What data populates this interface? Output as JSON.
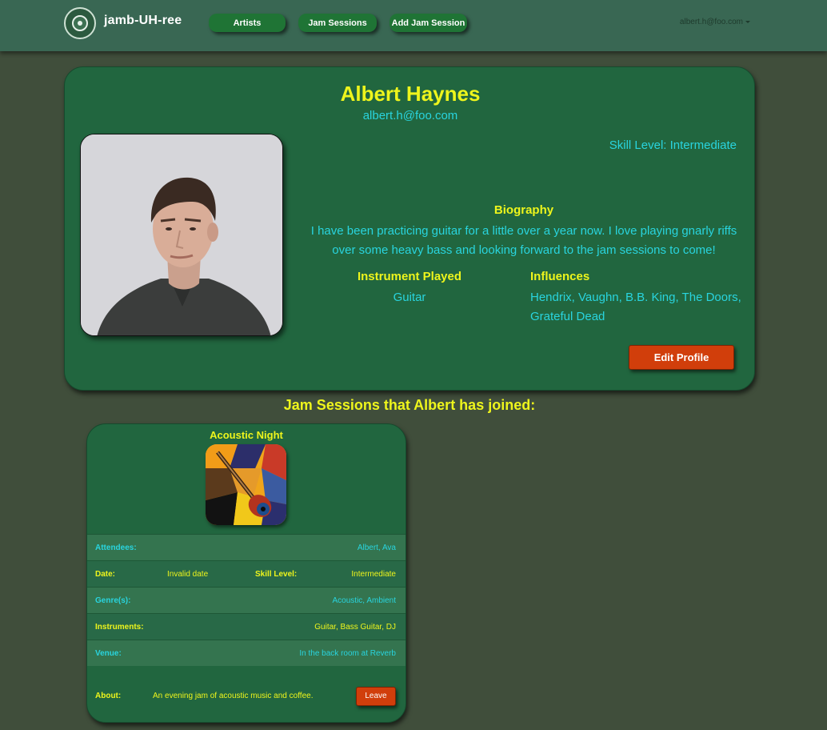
{
  "navbar": {
    "brand": "jamb-UH-ree",
    "links": [
      "Artists",
      "Jam Sessions",
      "Add Jam Session"
    ],
    "user_email": "albert.h@foo.com",
    "logo_icon": "circular-seal-logo-icon"
  },
  "profile": {
    "name": "Albert Haynes",
    "email": "albert.h@foo.com",
    "skill_level": "Skill Level: Intermediate",
    "biography_title": "Biography",
    "biography": "I have been practicing guitar for a little over a year now. I love playing gnarly riffs over some heavy bass and looking forward to the jam sessions to come!",
    "instrument_title": "Instrument Played",
    "instrument": "Guitar",
    "influences_title": "Influences",
    "influences": "Hendrix, Vaughn, B.B. King, The Doors, Grateful Dead",
    "edit_button": "Edit Profile"
  },
  "sessions_heading": "Jam Sessions that Albert has joined:",
  "session": {
    "title": "Acoustic Night",
    "attendees_label": "Attendees:",
    "attendees": "Albert, Ava",
    "date_label": "Date:",
    "date": "Invalid date",
    "skill_label": "Skill Level:",
    "skill": "Intermediate",
    "genres_label": "Genre(s):",
    "genres": "Acoustic, Ambient",
    "instruments_label": "Instruments:",
    "instruments": "Guitar, Bass Guitar, DJ",
    "venue_label": "Venue:",
    "venue": "In the back room at Reverb",
    "about_label": "About:",
    "about": "An evening jam of acoustic music and coffee.",
    "leave_button": "Leave"
  },
  "colors": {
    "background": "#404e3b",
    "navbar": "#396753",
    "card": "#21663f",
    "accent_yellow": "#eef51c",
    "accent_cyan": "#29d4de",
    "button_orange": "#d13e0b",
    "nav_button": "#1f7435"
  }
}
